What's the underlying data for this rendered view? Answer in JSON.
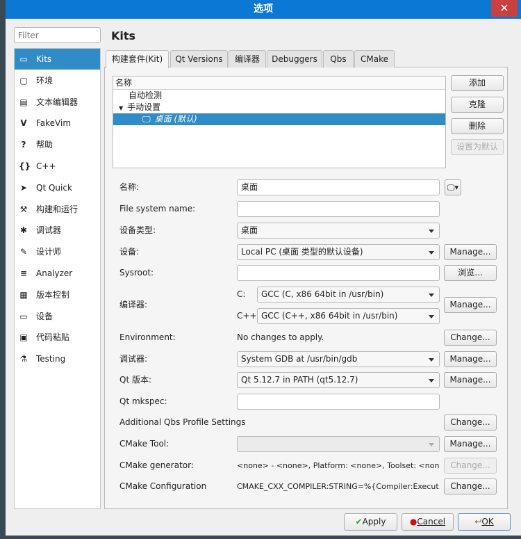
{
  "window": {
    "title": "选项",
    "close": "✕"
  },
  "filter": {
    "placeholder": "Filter"
  },
  "sidebar": {
    "items": [
      {
        "label": "Kits",
        "icon": "kits-icon",
        "glyph": "▭"
      },
      {
        "label": "环境",
        "icon": "monitor-icon",
        "glyph": "▢"
      },
      {
        "label": "文本编辑器",
        "icon": "text-editor-icon",
        "glyph": "▤"
      },
      {
        "label": "FakeVim",
        "icon": "fakevim-icon",
        "glyph": "V"
      },
      {
        "label": "帮助",
        "icon": "help-icon",
        "glyph": "?"
      },
      {
        "label": "C++",
        "icon": "braces-icon",
        "glyph": "{}"
      },
      {
        "label": "Qt Quick",
        "icon": "qtquick-icon",
        "glyph": "➤"
      },
      {
        "label": "构建和运行",
        "icon": "hammer-icon",
        "glyph": "⚒"
      },
      {
        "label": "调试器",
        "icon": "bug-icon",
        "glyph": "✱"
      },
      {
        "label": "设计师",
        "icon": "pencil-icon",
        "glyph": "✎"
      },
      {
        "label": "Analyzer",
        "icon": "analyzer-icon",
        "glyph": "≡"
      },
      {
        "label": "版本控制",
        "icon": "version-control-icon",
        "glyph": "▦"
      },
      {
        "label": "设备",
        "icon": "device-icon",
        "glyph": "▭"
      },
      {
        "label": "代码粘贴",
        "icon": "paste-icon",
        "glyph": "▣"
      },
      {
        "label": "Testing",
        "icon": "flask-icon",
        "glyph": "⚗"
      }
    ]
  },
  "page": {
    "title": "Kits"
  },
  "tabs": [
    "构建套件(Kit)",
    "Qt Versions",
    "编译器",
    "Debuggers",
    "Qbs",
    "CMake"
  ],
  "tree": {
    "header": "名称",
    "items": [
      "自动检测",
      "手动设置",
      "桌面 (默认)"
    ]
  },
  "kit_buttons": {
    "add": "添加",
    "clone": "克隆",
    "remove": "删除",
    "make_default": "设置为默认"
  },
  "form": {
    "name": {
      "label": "名称:",
      "value": "桌面"
    },
    "fs_name": {
      "label": "File system name:",
      "value": ""
    },
    "device_type": {
      "label": "设备类型:",
      "value": "桌面"
    },
    "device": {
      "label": "设备:",
      "value": "Local PC (桌面 类型的默认设备)",
      "button": "Manage..."
    },
    "sysroot": {
      "label": "Sysroot:",
      "value": "",
      "button": "浏览..."
    },
    "compiler": {
      "label": "编译器:",
      "c_label": "C:",
      "c_value": "GCC (C, x86 64bit in /usr/bin)",
      "cxx_label": "C++:",
      "cxx_value": "GCC (C++, x86 64bit in /usr/bin)",
      "button": "Manage..."
    },
    "environment": {
      "label": "Environment:",
      "value": "No changes to apply.",
      "button": "Change..."
    },
    "debugger": {
      "label": "调试器:",
      "value": "System GDB at /usr/bin/gdb",
      "button": "Manage..."
    },
    "qt_version": {
      "label": "Qt 版本:",
      "value": "Qt 5.12.7 in PATH (qt5.12.7)",
      "button": "Manage..."
    },
    "qt_mkspec": {
      "label": "Qt mkspec:",
      "value": ""
    },
    "qbs_profile": {
      "label": "Additional Qbs Profile Settings",
      "button": "Change..."
    },
    "cmake_tool": {
      "label": "CMake Tool:",
      "value": "",
      "button": "Manage..."
    },
    "cmake_generator": {
      "label": "CMake generator:",
      "value": "<none> - <none>, Platform: <none>, Toolset: <none>",
      "button": "Change..."
    },
    "cmake_config": {
      "label": "CMake Configuration",
      "value": "CMAKE_CXX_COMPILER:STRING=%{Compiler:Execut…",
      "button": "Change..."
    }
  },
  "dialog_buttons": {
    "apply": "Apply",
    "cancel": "Cancel",
    "ok": "OK"
  },
  "colors": {
    "titlebar": "#0a78d4",
    "selection": "#308cc6"
  }
}
